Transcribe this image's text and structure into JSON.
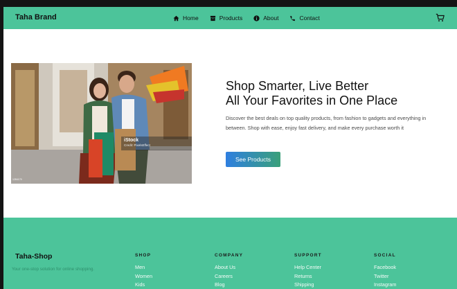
{
  "navbar": {
    "brand": "Taha Brand",
    "links": [
      {
        "label": "Home",
        "icon": "home-icon"
      },
      {
        "label": "Products",
        "icon": "box-icon"
      },
      {
        "label": "About",
        "icon": "info-icon"
      },
      {
        "label": "Contact",
        "icon": "phone-icon"
      }
    ],
    "cart_icon": "cart-icon"
  },
  "hero": {
    "headline_line1": "Shop Smarter, Live Better",
    "headline_line2": "All Your Favorites in One Place",
    "description": "Discover the best deals on top quality products, from fashion to gadgets and everything in between. Shop with ease, enjoy fast delivery, and make every purchase worth it",
    "cta_label": "See Products",
    "image": {
      "watermark": "iStock",
      "credit": "Credit: PixelsEffect",
      "id": "1284179"
    }
  },
  "footer": {
    "brand": "Taha-Shop",
    "tagline": "Your one-stop solution for online shopping.",
    "columns": [
      {
        "heading": "SHOP",
        "links": [
          "Men",
          "Women",
          "Kids"
        ]
      },
      {
        "heading": "COMPANY",
        "links": [
          "About Us",
          "Careers",
          "Blog"
        ]
      },
      {
        "heading": "SUPPORT",
        "links": [
          "Help Center",
          "Returns",
          "Shipping"
        ]
      },
      {
        "heading": "SOCIAL",
        "links": [
          "Facebook",
          "Twitter",
          "Instagram"
        ]
      }
    ]
  },
  "colors": {
    "brand_green": "#4cc49a",
    "cta_blue": "#2f7fe0",
    "cta_green": "#3aa07a"
  }
}
